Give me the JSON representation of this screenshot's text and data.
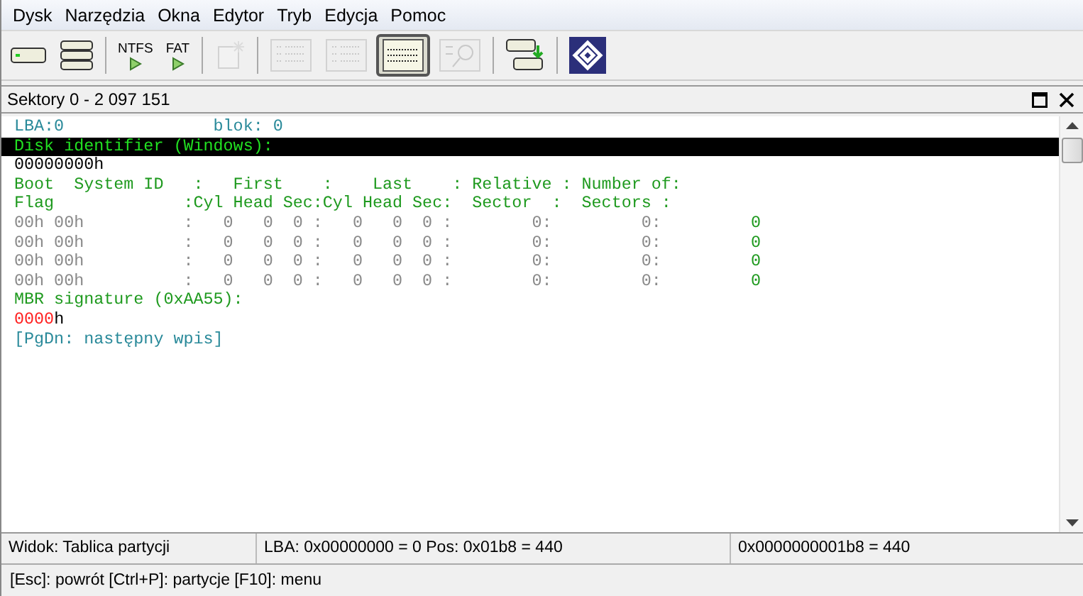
{
  "menu": [
    "Dysk",
    "Narzędzia",
    "Okna",
    "Edytor",
    "Tryb",
    "Edycja",
    "Pomoc"
  ],
  "toolbar": [
    {
      "kind": "drive",
      "disabled": false,
      "selected": false
    },
    {
      "kind": "disks",
      "disabled": false,
      "selected": false
    },
    {
      "kind": "sep"
    },
    {
      "kind": "fs",
      "label": "NTFS",
      "disabled": false,
      "selected": false
    },
    {
      "kind": "fs",
      "label": "FAT",
      "disabled": false,
      "selected": false
    },
    {
      "kind": "sep"
    },
    {
      "kind": "newdoc",
      "disabled": true,
      "selected": false
    },
    {
      "kind": "sep"
    },
    {
      "kind": "tree",
      "disabled": true,
      "selected": false
    },
    {
      "kind": "list",
      "disabled": true,
      "selected": false
    },
    {
      "kind": "table",
      "disabled": false,
      "selected": true
    },
    {
      "kind": "find",
      "disabled": true,
      "selected": false
    },
    {
      "kind": "sep"
    },
    {
      "kind": "copy",
      "disabled": false,
      "selected": false
    },
    {
      "kind": "sep"
    },
    {
      "kind": "logo",
      "disabled": false,
      "selected": false
    }
  ],
  "panel": {
    "title": "Sektory 0 - 2 097 151"
  },
  "lines": [
    {
      "highlight": false,
      "segments": [
        {
          "text": "LBA:0               blok: 0",
          "color": "#2a8a9a"
        }
      ]
    },
    {
      "highlight": true,
      "segments": [
        {
          "text": "Disk identifier (Windows):"
        }
      ]
    },
    {
      "highlight": false,
      "segments": [
        {
          "text": "00000000h",
          "color": "#000000"
        }
      ]
    },
    {
      "highlight": false,
      "segments": [
        {
          "text": "Boot  System ID   :   First    :    Last    : Relative : Number of:",
          "color": "#1f9a1f"
        }
      ]
    },
    {
      "highlight": false,
      "segments": [
        {
          "text": "Flag             :Cyl Head Sec:Cyl Head Sec:  Sector  :  Sectors :",
          "color": "#1f9a1f"
        }
      ]
    },
    {
      "highlight": false,
      "segments": [
        {
          "text": "00h 00h          :   0   0  0 :   0   0  0 :        0:         0:",
          "color": "#8a8a8a"
        },
        {
          "text": "         0",
          "color": "#1f9a1f"
        }
      ]
    },
    {
      "highlight": false,
      "segments": [
        {
          "text": "00h 00h          :   0   0  0 :   0   0  0 :        0:         0:",
          "color": "#8a8a8a"
        },
        {
          "text": "         0",
          "color": "#1f9a1f"
        }
      ]
    },
    {
      "highlight": false,
      "segments": [
        {
          "text": "00h 00h          :   0   0  0 :   0   0  0 :        0:         0:",
          "color": "#8a8a8a"
        },
        {
          "text": "         0",
          "color": "#1f9a1f"
        }
      ]
    },
    {
      "highlight": false,
      "segments": [
        {
          "text": "00h 00h          :   0   0  0 :   0   0  0 :        0:         0:",
          "color": "#8a8a8a"
        },
        {
          "text": "         0",
          "color": "#1f9a1f"
        }
      ]
    },
    {
      "highlight": false,
      "segments": [
        {
          "text": "MBR signature (0xAA55):",
          "color": "#1f9a1f"
        }
      ]
    },
    {
      "highlight": false,
      "segments": [
        {
          "text": "0000",
          "color": "#ff2020"
        },
        {
          "text": "h",
          "color": "#000000"
        }
      ]
    },
    {
      "highlight": false,
      "segments": [
        {
          "text": "[PgDn: następny wpis]",
          "color": "#2a8a9a"
        }
      ]
    }
  ],
  "status_bar": [
    "Widok: Tablica partycji",
    "LBA: 0x00000000 = 0  Pos: 0x01b8 = 440",
    "0x0000000001b8 = 440"
  ],
  "hint_bar": "[Esc]: powrót  [Ctrl+P]: partycje  [F10]: menu"
}
